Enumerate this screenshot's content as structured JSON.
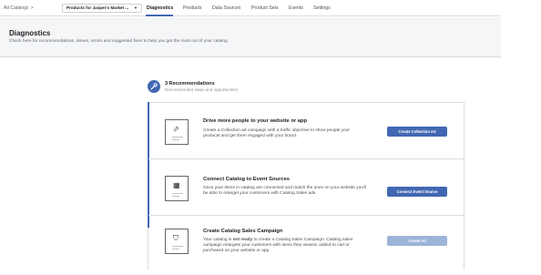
{
  "nav": {
    "breadcrumb": "All Catalogs",
    "breadcrumb_chevron": ">",
    "catalog_name": "Products for Jasper's Market ...",
    "catalog_caret": "▼",
    "tabs": [
      "Diagnostics",
      "Products",
      "Data Sources",
      "Product Sets",
      "Events",
      "Settings"
    ],
    "active_tab": "Diagnostics"
  },
  "header": {
    "title": "Diagnostics",
    "description": "Check here for recommendations, issues, errors and suggested fixes to help you get the most out of your catalog."
  },
  "recommendations": {
    "title": "3 Recommendations",
    "subtitle": "Recommended steps and opportunities",
    "icon": "wrench-icon",
    "items": [
      {
        "title": "Drive more people to your website or app",
        "description": "Create a Collection ad campaign with a traffic objective to show people your products and get them engaged with your brand.",
        "button": "Create Collection Ad",
        "icon": "cursor-icon",
        "glyph": "⬀"
      },
      {
        "title": "Connect Catalog to Event Sources",
        "description": "Once your items in catalog are connected and match the ones on your website you'll be able to retarget your customers with Catalog Sales ads.",
        "button": "Connect Event Source",
        "icon": "calendar-icon",
        "glyph": "▦"
      },
      {
        "title": "Create Catalog Sales Campaign",
        "description_prefix": "Your catalog is ",
        "description_strong": "not ready",
        "description_suffix": " to create a Catalog Sales Campaign. Catalog sales campaign retargets your customers with items they viewed, added to cart or purchased on your website or app.",
        "button": "Create Ad",
        "icon": "shopping-bag-icon",
        "glyph": "⛉"
      }
    ]
  },
  "colors": {
    "accent": "#4267b2",
    "disabled_button": "#9cb4d8",
    "header_bg": "#f5f6f7"
  }
}
